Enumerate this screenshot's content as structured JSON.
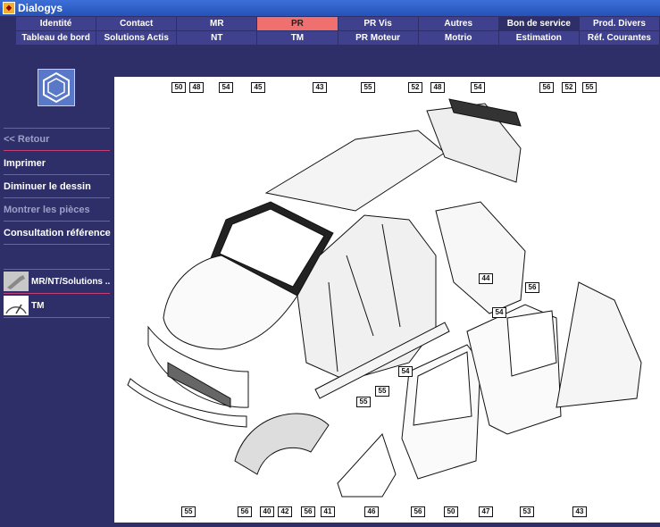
{
  "window": {
    "title": "Dialogys"
  },
  "menu": {
    "row1": [
      "Identité",
      "Contact",
      "MR",
      "PR",
      "PR Vis",
      "Autres",
      "Bon de service",
      "Prod. Divers"
    ],
    "row2": [
      "Tableau de bord",
      "Solutions Actis",
      "NT",
      "TM",
      "PR Moteur",
      "Motrio",
      "Estimation",
      "Réf. Courantes"
    ],
    "active": "PR"
  },
  "sidebar": {
    "back": "<< Retour",
    "print": "Imprimer",
    "shrink": "Diminuer le dessin",
    "show_parts": "Montrer les pièces",
    "reference": "Consultation référence",
    "mr_link": "MR/NT/Solutions ...",
    "tm_link": "TM"
  },
  "callouts": [
    {
      "id": "c50a",
      "text": "50"
    },
    {
      "id": "c48a",
      "text": "48"
    },
    {
      "id": "c54a",
      "text": "54"
    },
    {
      "id": "c45",
      "text": "45"
    },
    {
      "id": "c43a",
      "text": "43"
    },
    {
      "id": "c55a",
      "text": "55"
    },
    {
      "id": "c52a",
      "text": "52"
    },
    {
      "id": "c48b",
      "text": "48"
    },
    {
      "id": "c54b",
      "text": "54"
    },
    {
      "id": "c56a",
      "text": "56"
    },
    {
      "id": "c52b",
      "text": "52"
    },
    {
      "id": "c55b",
      "text": "55"
    },
    {
      "id": "c44",
      "text": "44"
    },
    {
      "id": "c54c",
      "text": "54"
    },
    {
      "id": "c56b",
      "text": "56"
    },
    {
      "id": "c54d",
      "text": "54"
    },
    {
      "id": "c55c",
      "text": "55"
    },
    {
      "id": "c55d",
      "text": "55"
    },
    {
      "id": "c55e",
      "text": "55"
    },
    {
      "id": "c56c",
      "text": "56"
    },
    {
      "id": "c40",
      "text": "40"
    },
    {
      "id": "c42",
      "text": "42"
    },
    {
      "id": "c56d",
      "text": "56"
    },
    {
      "id": "c41",
      "text": "41"
    },
    {
      "id": "c46",
      "text": "46"
    },
    {
      "id": "c56e",
      "text": "56"
    },
    {
      "id": "c50b",
      "text": "50"
    },
    {
      "id": "c47",
      "text": "47"
    },
    {
      "id": "c53",
      "text": "53"
    },
    {
      "id": "c43b",
      "text": "43"
    }
  ]
}
